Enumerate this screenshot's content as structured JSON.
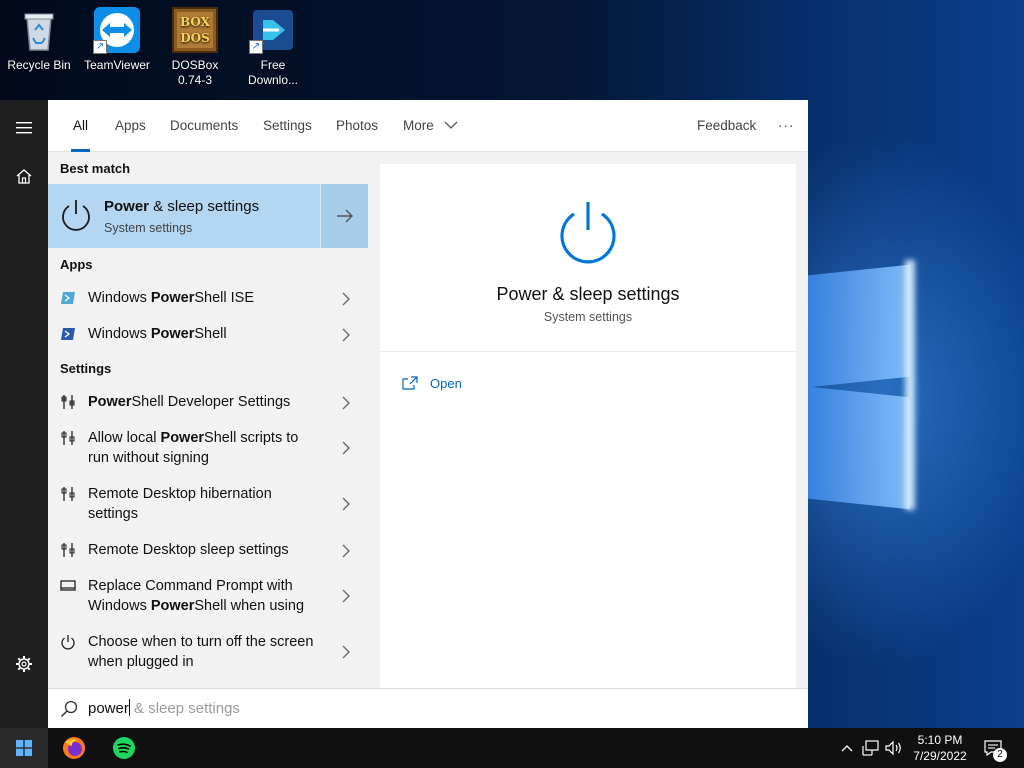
{
  "desktop": {
    "icons": [
      {
        "label": "Recycle Bin"
      },
      {
        "label": "TeamViewer"
      },
      {
        "label": "DOSBox\n0.74-3",
        "line1": "DOSBox",
        "line2": "0.74-3"
      },
      {
        "label": "Free Downlo...",
        "line1": "Free",
        "line2": "Downlo..."
      }
    ]
  },
  "tabs": {
    "all": "All",
    "apps": "Apps",
    "documents": "Documents",
    "settings": "Settings",
    "photos": "Photos",
    "more": "More",
    "feedback": "Feedback",
    "overflow": "···"
  },
  "results": {
    "best_match_header": "Best match",
    "best_match": {
      "title_bold": "Power",
      "title_rest": " & sleep settings",
      "subtitle": "System settings"
    },
    "apps_header": "Apps",
    "apps": [
      {
        "pre": "Windows ",
        "bold": "Power",
        "post": "Shell ISE"
      },
      {
        "pre": "Windows ",
        "bold": "Power",
        "post": "Shell"
      }
    ],
    "settings_header": "Settings",
    "settings": [
      {
        "pre": "",
        "bold": "Power",
        "post": "Shell Developer Settings"
      },
      {
        "pre": "Allow local ",
        "bold": "Power",
        "post": "Shell scripts to run without signing"
      },
      {
        "pre": "Remote Desktop hibernation settings",
        "bold": "",
        "post": ""
      },
      {
        "pre": "Remote Desktop sleep settings",
        "bold": "",
        "post": ""
      },
      {
        "pre": "Replace Command Prompt with Windows ",
        "bold": "Power",
        "post": "Shell when using"
      },
      {
        "pre": "Choose when to turn off the screen when plugged in",
        "bold": "",
        "post": ""
      }
    ]
  },
  "preview": {
    "title": "Power & sleep settings",
    "subtitle": "System settings",
    "open_label": "Open"
  },
  "search": {
    "typed": "power",
    "suggestion": " & sleep settings"
  },
  "taskbar": {
    "time": "5:10 PM",
    "date": "7/29/2022",
    "notification_count": "2"
  },
  "colors": {
    "accent": "#0067c0",
    "best_match_bg": "#b3d7f2",
    "power_icon": "#0078d4"
  }
}
